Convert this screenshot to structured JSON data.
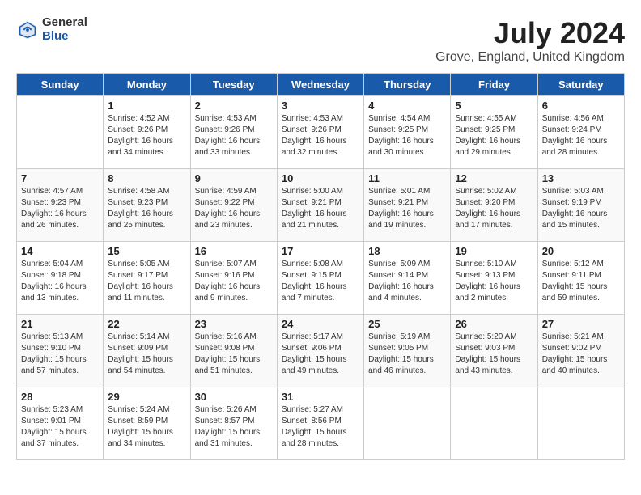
{
  "header": {
    "logo_general": "General",
    "logo_blue": "Blue",
    "title": "July 2024",
    "location": "Grove, England, United Kingdom"
  },
  "calendar": {
    "days_of_week": [
      "Sunday",
      "Monday",
      "Tuesday",
      "Wednesday",
      "Thursday",
      "Friday",
      "Saturday"
    ],
    "weeks": [
      [
        {
          "day": "",
          "info": ""
        },
        {
          "day": "1",
          "info": "Sunrise: 4:52 AM\nSunset: 9:26 PM\nDaylight: 16 hours\nand 34 minutes."
        },
        {
          "day": "2",
          "info": "Sunrise: 4:53 AM\nSunset: 9:26 PM\nDaylight: 16 hours\nand 33 minutes."
        },
        {
          "day": "3",
          "info": "Sunrise: 4:53 AM\nSunset: 9:26 PM\nDaylight: 16 hours\nand 32 minutes."
        },
        {
          "day": "4",
          "info": "Sunrise: 4:54 AM\nSunset: 9:25 PM\nDaylight: 16 hours\nand 30 minutes."
        },
        {
          "day": "5",
          "info": "Sunrise: 4:55 AM\nSunset: 9:25 PM\nDaylight: 16 hours\nand 29 minutes."
        },
        {
          "day": "6",
          "info": "Sunrise: 4:56 AM\nSunset: 9:24 PM\nDaylight: 16 hours\nand 28 minutes."
        }
      ],
      [
        {
          "day": "7",
          "info": "Sunrise: 4:57 AM\nSunset: 9:23 PM\nDaylight: 16 hours\nand 26 minutes."
        },
        {
          "day": "8",
          "info": "Sunrise: 4:58 AM\nSunset: 9:23 PM\nDaylight: 16 hours\nand 25 minutes."
        },
        {
          "day": "9",
          "info": "Sunrise: 4:59 AM\nSunset: 9:22 PM\nDaylight: 16 hours\nand 23 minutes."
        },
        {
          "day": "10",
          "info": "Sunrise: 5:00 AM\nSunset: 9:21 PM\nDaylight: 16 hours\nand 21 minutes."
        },
        {
          "day": "11",
          "info": "Sunrise: 5:01 AM\nSunset: 9:21 PM\nDaylight: 16 hours\nand 19 minutes."
        },
        {
          "day": "12",
          "info": "Sunrise: 5:02 AM\nSunset: 9:20 PM\nDaylight: 16 hours\nand 17 minutes."
        },
        {
          "day": "13",
          "info": "Sunrise: 5:03 AM\nSunset: 9:19 PM\nDaylight: 16 hours\nand 15 minutes."
        }
      ],
      [
        {
          "day": "14",
          "info": "Sunrise: 5:04 AM\nSunset: 9:18 PM\nDaylight: 16 hours\nand 13 minutes."
        },
        {
          "day": "15",
          "info": "Sunrise: 5:05 AM\nSunset: 9:17 PM\nDaylight: 16 hours\nand 11 minutes."
        },
        {
          "day": "16",
          "info": "Sunrise: 5:07 AM\nSunset: 9:16 PM\nDaylight: 16 hours\nand 9 minutes."
        },
        {
          "day": "17",
          "info": "Sunrise: 5:08 AM\nSunset: 9:15 PM\nDaylight: 16 hours\nand 7 minutes."
        },
        {
          "day": "18",
          "info": "Sunrise: 5:09 AM\nSunset: 9:14 PM\nDaylight: 16 hours\nand 4 minutes."
        },
        {
          "day": "19",
          "info": "Sunrise: 5:10 AM\nSunset: 9:13 PM\nDaylight: 16 hours\nand 2 minutes."
        },
        {
          "day": "20",
          "info": "Sunrise: 5:12 AM\nSunset: 9:11 PM\nDaylight: 15 hours\nand 59 minutes."
        }
      ],
      [
        {
          "day": "21",
          "info": "Sunrise: 5:13 AM\nSunset: 9:10 PM\nDaylight: 15 hours\nand 57 minutes."
        },
        {
          "day": "22",
          "info": "Sunrise: 5:14 AM\nSunset: 9:09 PM\nDaylight: 15 hours\nand 54 minutes."
        },
        {
          "day": "23",
          "info": "Sunrise: 5:16 AM\nSunset: 9:08 PM\nDaylight: 15 hours\nand 51 minutes."
        },
        {
          "day": "24",
          "info": "Sunrise: 5:17 AM\nSunset: 9:06 PM\nDaylight: 15 hours\nand 49 minutes."
        },
        {
          "day": "25",
          "info": "Sunrise: 5:19 AM\nSunset: 9:05 PM\nDaylight: 15 hours\nand 46 minutes."
        },
        {
          "day": "26",
          "info": "Sunrise: 5:20 AM\nSunset: 9:03 PM\nDaylight: 15 hours\nand 43 minutes."
        },
        {
          "day": "27",
          "info": "Sunrise: 5:21 AM\nSunset: 9:02 PM\nDaylight: 15 hours\nand 40 minutes."
        }
      ],
      [
        {
          "day": "28",
          "info": "Sunrise: 5:23 AM\nSunset: 9:01 PM\nDaylight: 15 hours\nand 37 minutes."
        },
        {
          "day": "29",
          "info": "Sunrise: 5:24 AM\nSunset: 8:59 PM\nDaylight: 15 hours\nand 34 minutes."
        },
        {
          "day": "30",
          "info": "Sunrise: 5:26 AM\nSunset: 8:57 PM\nDaylight: 15 hours\nand 31 minutes."
        },
        {
          "day": "31",
          "info": "Sunrise: 5:27 AM\nSunset: 8:56 PM\nDaylight: 15 hours\nand 28 minutes."
        },
        {
          "day": "",
          "info": ""
        },
        {
          "day": "",
          "info": ""
        },
        {
          "day": "",
          "info": ""
        }
      ]
    ]
  }
}
